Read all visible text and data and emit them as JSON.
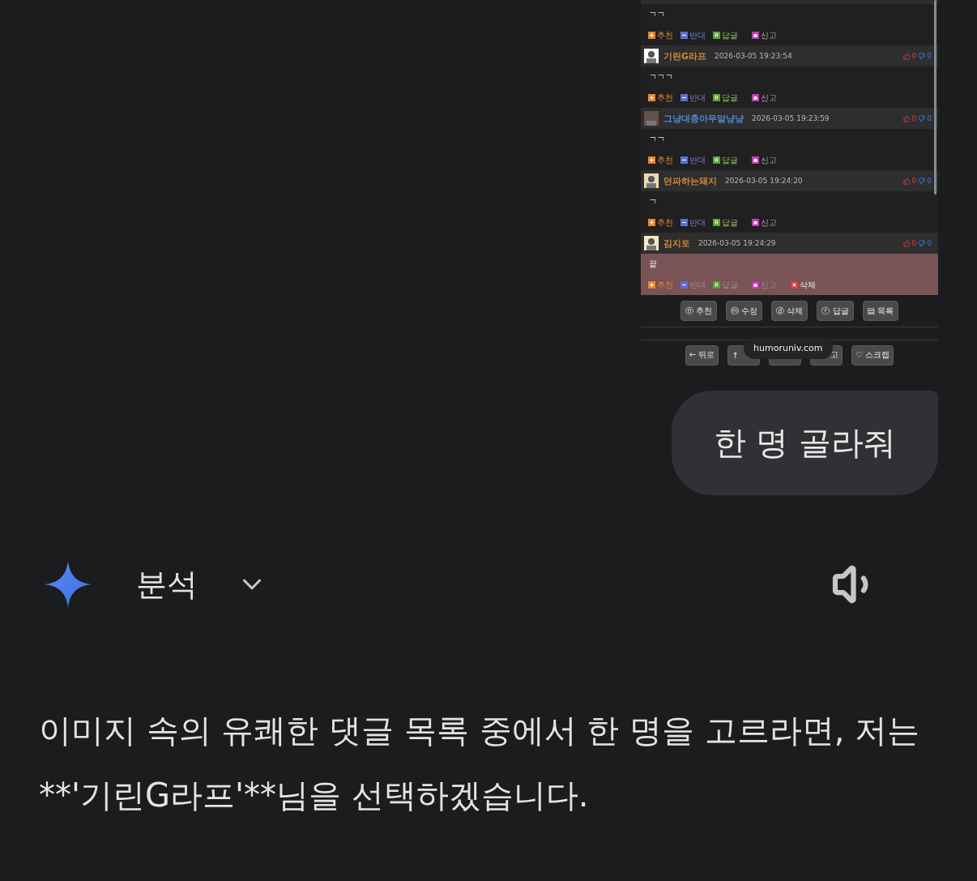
{
  "shared_screenshot": {
    "comments": [
      {
        "body": "ㄱㄱ",
        "highlighted": false,
        "actions": [
          {
            "kind": "recommend",
            "label": "추천"
          },
          {
            "kind": "oppose",
            "label": "반대"
          },
          {
            "kind": "reply",
            "label": "답글"
          },
          {
            "kind": "report",
            "label": "신고"
          }
        ]
      },
      {
        "header": {
          "name": "기린G라프",
          "color": "#d08a3c",
          "date": "2026-03-05 19:23:54",
          "up": "0",
          "down": "0"
        },
        "body": "ㄱㄱㄱ",
        "highlighted": false,
        "actions": [
          {
            "kind": "recommend",
            "label": "추천"
          },
          {
            "kind": "oppose",
            "label": "반대"
          },
          {
            "kind": "reply",
            "label": "답글"
          },
          {
            "kind": "report",
            "label": "신고"
          }
        ]
      },
      {
        "header": {
          "name": "그냥대충아무말냥냥",
          "color": "#4f86d6",
          "date": "2026-03-05 19:23:59",
          "up": "0",
          "down": "0"
        },
        "body": "ㄱㄱ",
        "highlighted": false,
        "actions": [
          {
            "kind": "recommend",
            "label": "추천"
          },
          {
            "kind": "oppose",
            "label": "반대"
          },
          {
            "kind": "reply",
            "label": "답글"
          },
          {
            "kind": "report",
            "label": "신고"
          }
        ]
      },
      {
        "header": {
          "name": "던파하는돼지",
          "color": "#d08a3c",
          "date": "2026-03-05 19:24:20",
          "up": "0",
          "down": "0"
        },
        "body": "ㄱ",
        "highlighted": false,
        "actions": [
          {
            "kind": "recommend",
            "label": "추천"
          },
          {
            "kind": "oppose",
            "label": "반대"
          },
          {
            "kind": "reply",
            "label": "답글"
          },
          {
            "kind": "report",
            "label": "신고"
          }
        ]
      },
      {
        "header": {
          "name": "김지토",
          "color": "#d08a3c",
          "date": "2026-03-05 19:24:29",
          "up": "0",
          "down": "0"
        },
        "body": "끝",
        "highlighted": true,
        "actions": [
          {
            "kind": "recommend",
            "label": "추천"
          },
          {
            "kind": "oppose",
            "label": "반대"
          },
          {
            "kind": "reply",
            "label": "답글"
          },
          {
            "kind": "report",
            "label": "신고"
          },
          {
            "kind": "delete",
            "label": "삭제"
          }
        ]
      }
    ],
    "post_buttons": [
      "ⓞ 추천",
      "ⓜ 수정",
      "ⓓ 삭제",
      "ⓡ 답글",
      "▤ 목록"
    ],
    "nav_buttons": [
      {
        "label": "← 뒤로"
      },
      {
        "label": "↑"
      },
      {
        "covered": true
      },
      {
        "label": "고"
      },
      {
        "label": "♡ 스크랩"
      }
    ],
    "source_chip": "humoruniv.com"
  },
  "user_message": "한 명 골라줘",
  "response_header": {
    "title": "분석",
    "expanded": false
  },
  "response_text": "이미지 속의 유쾌한 댓글 목록 중에서 한 명을 고르라면, 저는 **'기린G라프'**님을 선택하겠습니다."
}
